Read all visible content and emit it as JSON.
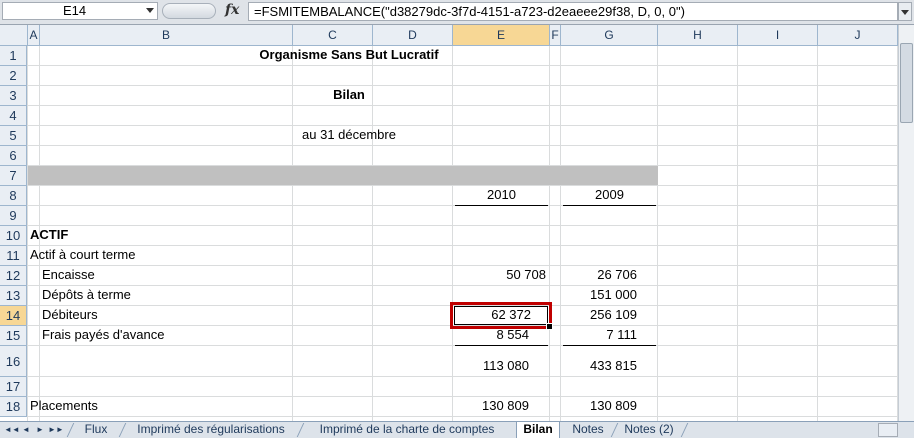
{
  "formula_bar": {
    "name_box": "E14",
    "fx": "fx",
    "formula": "=FSMITEMBALANCE(\"d38279dc-3f7d-4151-a723-d2eaeee29f38, D, 0, 0\")"
  },
  "columns": [
    "A",
    "B",
    "C",
    "D",
    "E",
    "F",
    "G",
    "H",
    "I",
    "J"
  ],
  "active_column": "E",
  "active_row": "14",
  "rows": [
    "1",
    "2",
    "3",
    "4",
    "5",
    "6",
    "7",
    "8",
    "9",
    "10",
    "11",
    "12",
    "13",
    "14",
    "15",
    "16",
    "17",
    "18"
  ],
  "cells": {
    "title": "Organisme Sans But Lucratif",
    "subtitle": "Bilan",
    "date": "au 31 décembre",
    "year_current": "2010",
    "year_prior": "2009",
    "actif": "ACTIF",
    "actif_court": "Actif à court terme",
    "encaisse": "Encaisse",
    "encaisse_2010": "50 708",
    "encaisse_2009": "26 706",
    "depots": "Dépôts à terme",
    "depots_2009": "151 000",
    "debiteurs": "Débiteurs",
    "debiteurs_2010": "62 372",
    "debiteurs_2009": "256 109",
    "frais": "Frais payés d'avance",
    "frais_2010": "8 554",
    "frais_2009": "7 111",
    "total_2010": "113 080",
    "total_2009": "433 815",
    "placements": "Placements",
    "placements_2010": "130 809",
    "placements_2009": "130 809"
  },
  "tabs": [
    "Flux",
    "Imprimé des régularisations",
    "Imprimé de la charte de comptes",
    "Bilan",
    "Notes",
    "Notes (2)"
  ],
  "active_tab": "Bilan",
  "nav_glyphs": [
    "◄◄",
    "◄",
    "►",
    "►►"
  ]
}
